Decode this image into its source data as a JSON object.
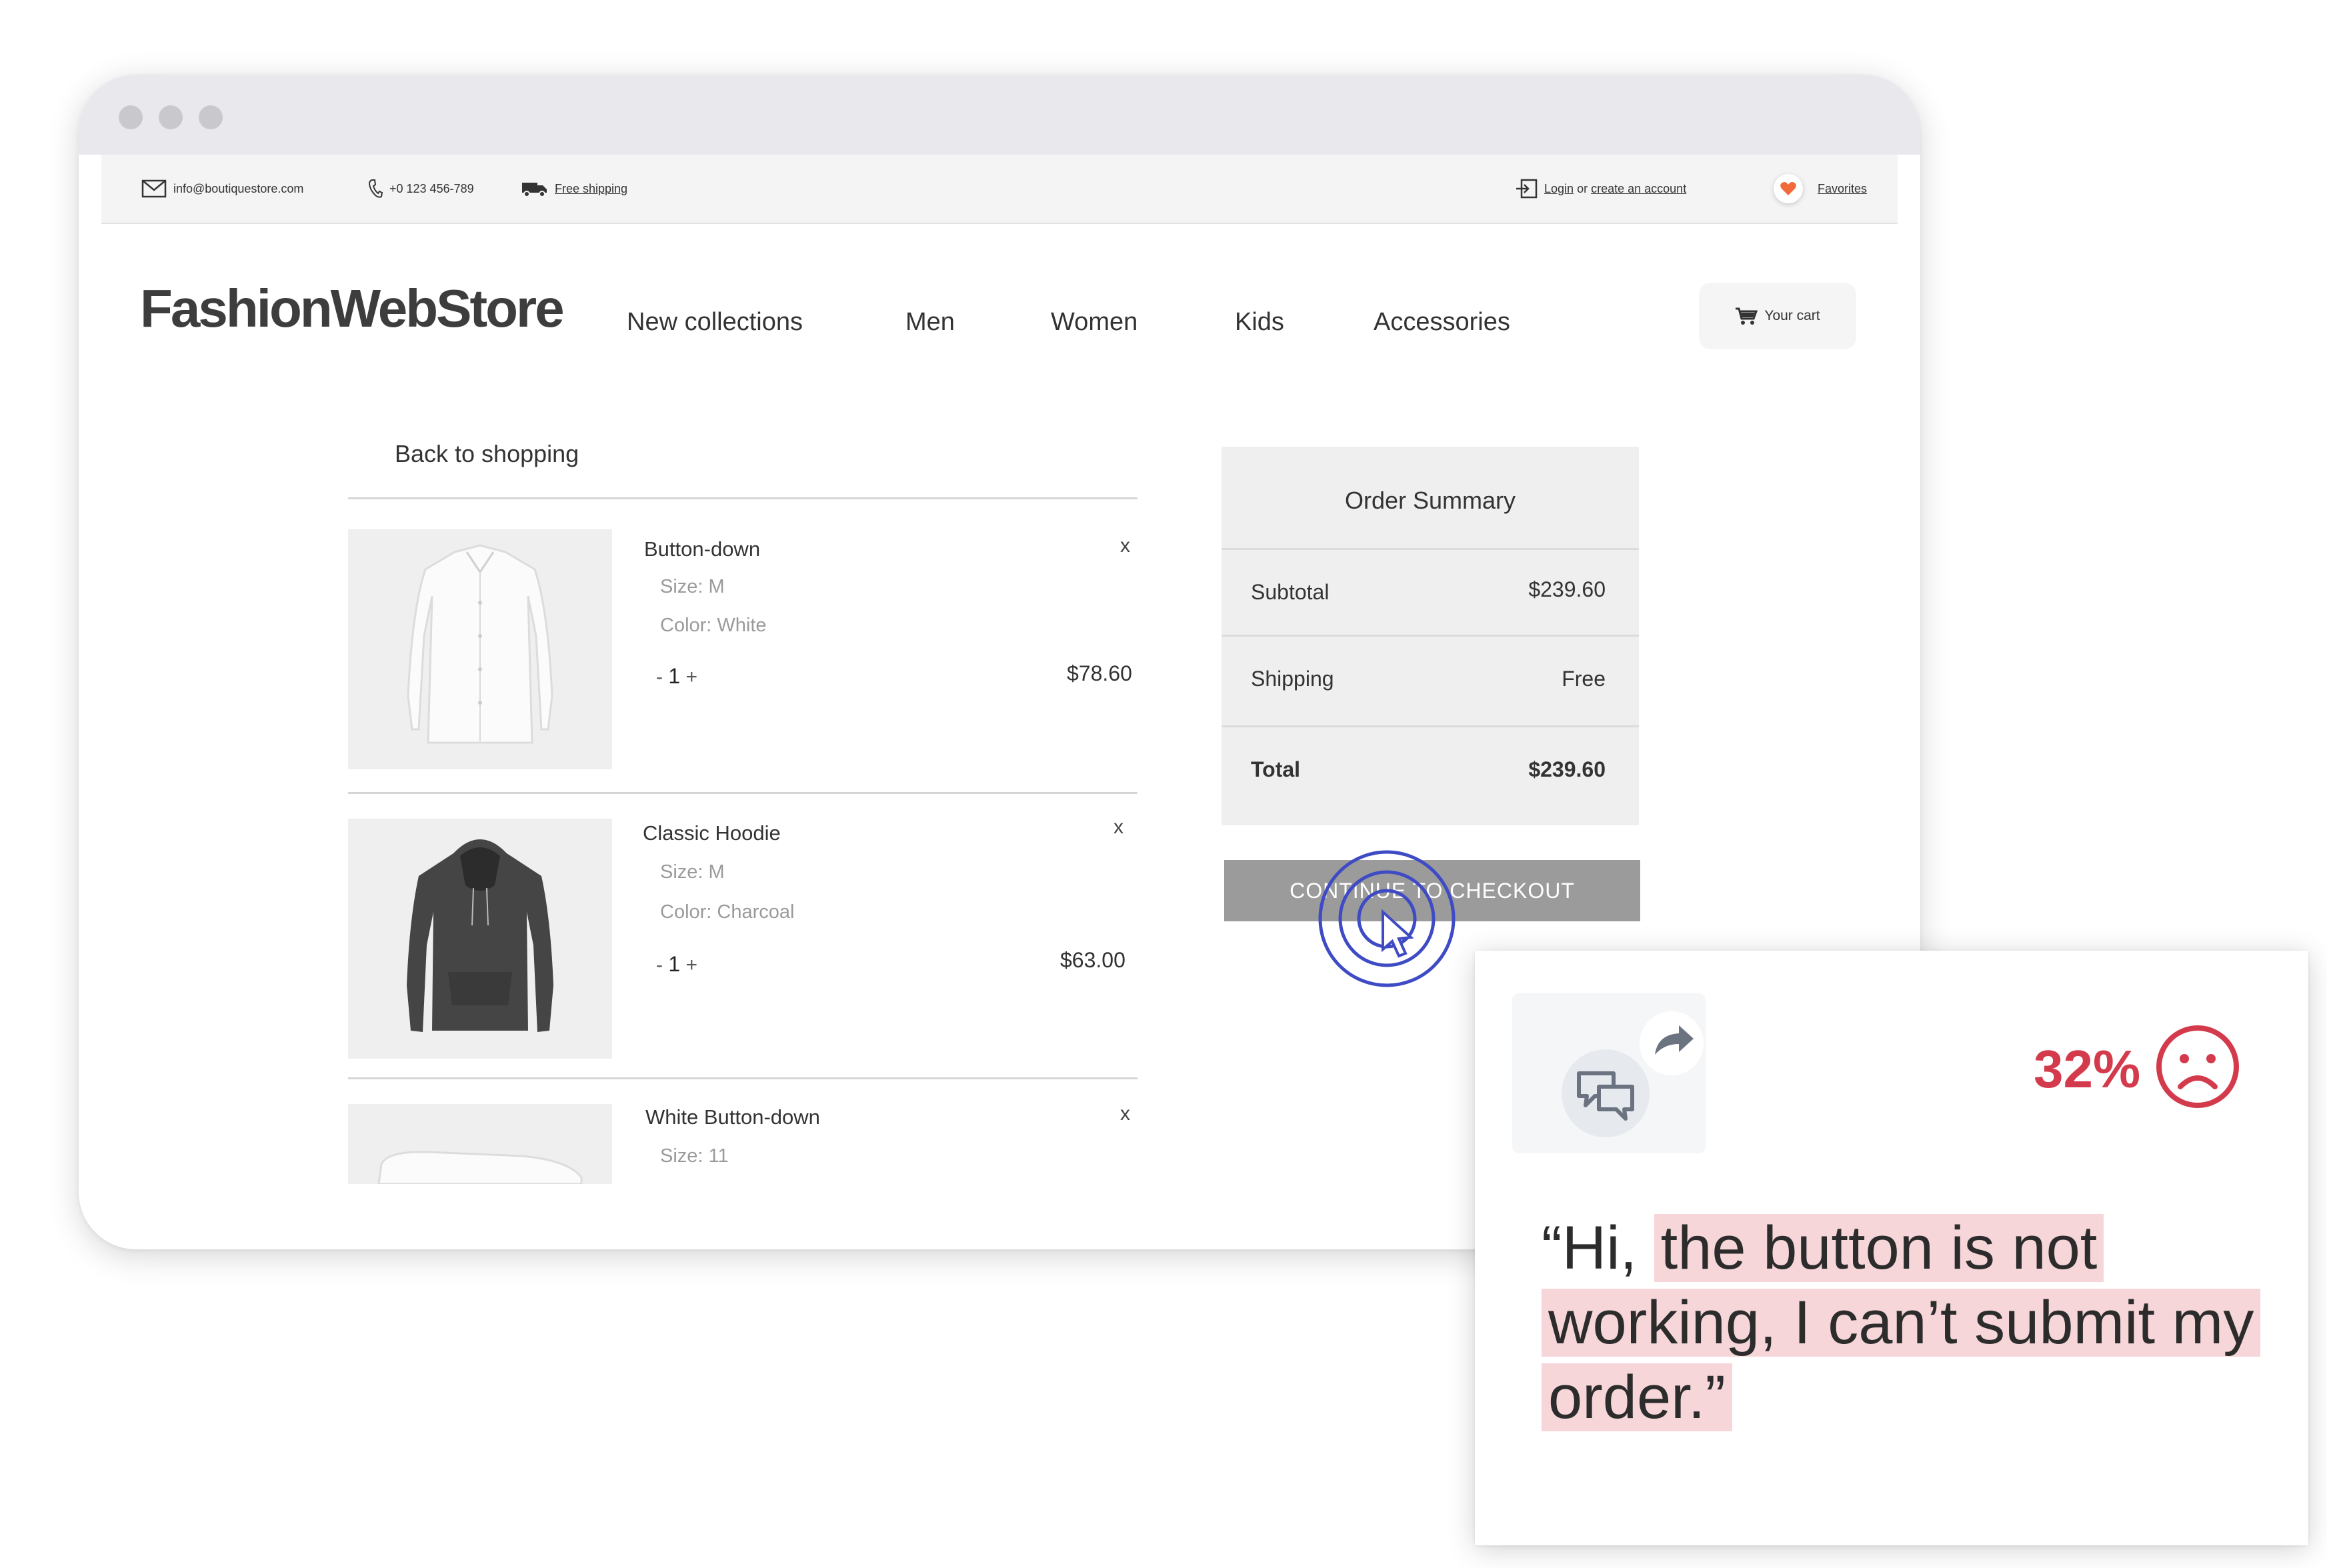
{
  "topbar": {
    "email": "info@boutiquestore.com",
    "phone": "+0 123 456-789",
    "shipping": "Free shipping",
    "login": "Login",
    "login_or": "or",
    "create_account": "create an account",
    "favorites": "Favorites"
  },
  "header": {
    "logo": "FashionWebStore",
    "nav": [
      "New collections",
      "Men",
      "Women",
      "Kids",
      "Accessories"
    ],
    "cart": "Your cart"
  },
  "cart": {
    "back": "Back to shopping",
    "remove_symbol": "x",
    "qty_minus": "-",
    "qty_plus": "+",
    "items": [
      {
        "name": "Button-down",
        "size": "Size: M",
        "color": "Color: White",
        "qty": "1",
        "price": "$78.60"
      },
      {
        "name": "Classic Hoodie",
        "size": "Size: M",
        "color": "Color: Charcoal",
        "qty": "1",
        "price": "$63.00"
      },
      {
        "name": "White Button-down",
        "size": "Size: 11"
      }
    ]
  },
  "summary": {
    "title": "Order Summary",
    "subtotal_label": "Subtotal",
    "subtotal_value": "$239.60",
    "shipping_label": "Shipping",
    "shipping_value": "Free",
    "total_label": "Total",
    "total_value": "$239.60",
    "checkout_label": "CONTINUE TO CHECKOUT"
  },
  "feedback": {
    "score": "32%",
    "quote_open": "“Hi, ",
    "quote_highlight": "the button is not working, I can’t submit my order.”"
  },
  "colors": {
    "accent_red": "#d33b4d",
    "highlight": "#f7d6d9",
    "checkout_button": "#9b9b9b",
    "click_ring": "#3f4bc4",
    "heart": "#f06a3a"
  },
  "icons": [
    "mail-icon",
    "phone-icon",
    "truck-icon",
    "login-icon",
    "heart-icon",
    "cart-icon",
    "chat-bubbles-icon",
    "share-arrow-icon",
    "sad-face-icon",
    "cursor-icon"
  ]
}
